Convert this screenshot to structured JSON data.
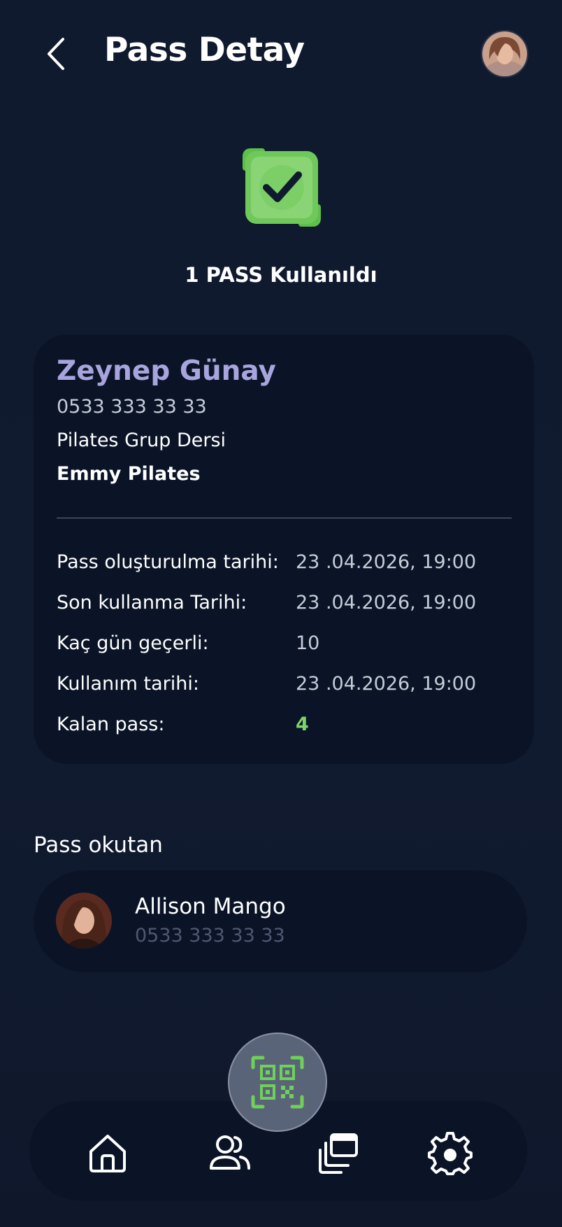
{
  "header": {
    "title": "Pass Detay",
    "back_icon": "chevron-left-icon",
    "avatar": "profile-avatar"
  },
  "status": {
    "icon": "check-square-icon",
    "text": "1 PASS Kullanıldı",
    "accent": "#7fd36b"
  },
  "member": {
    "name": "Zeynep Günay",
    "phone": "0533 333 33 33",
    "service": "Pilates Grup Dersi",
    "studio": "Emmy Pilates"
  },
  "details": [
    {
      "label": "Pass oluşturulma tarihi:",
      "value": "23 .04.2026, 19:00"
    },
    {
      "label": "Son kullanma Tarihi:",
      "value": "23 .04.2026, 19:00"
    },
    {
      "label": "Kaç gün geçerli:",
      "value": "10"
    },
    {
      "label": "Kullanım tarihi:",
      "value": "23 .04.2026, 19:00"
    },
    {
      "label": "Kalan pass:",
      "value": "4"
    }
  ],
  "scanner": {
    "section_title": "Pass okutan",
    "name": "Allison Mango",
    "phone": "0533 333 33 33"
  },
  "nav": {
    "items": [
      "home-icon",
      "users-icon",
      "passes-icon",
      "settings-icon"
    ],
    "center": "qr-scan-icon"
  },
  "colors": {
    "background": "#101a2e",
    "card": "#0b1427",
    "name_accent": "#a8a5de",
    "green": "#7fd36b"
  }
}
